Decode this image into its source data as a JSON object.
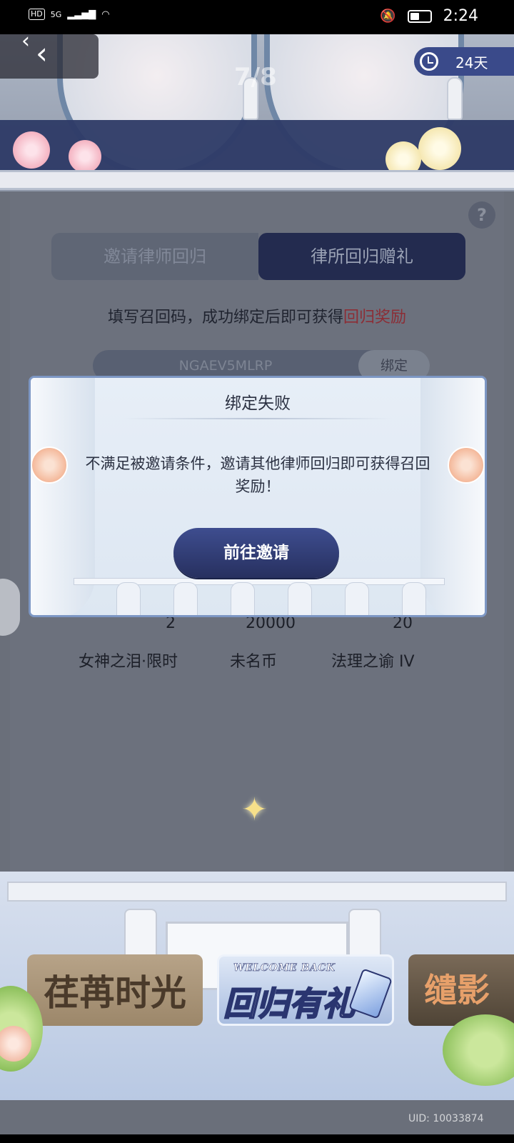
{
  "status_bar": {
    "hd": "HD",
    "network": "5G",
    "time": "2:24"
  },
  "header": {
    "page_indicator": "7/8",
    "timer": "24天"
  },
  "tabs": [
    {
      "label": "邀请律师回归",
      "active": false
    },
    {
      "label": "律所回归赠礼",
      "active": true
    }
  ],
  "instruction": {
    "text": "填写召回码，成功绑定后即可获得",
    "highlight": "回归奖励"
  },
  "code_input": {
    "value": "NGAEV5MLRP",
    "bind_label": "绑定"
  },
  "rewards": [
    {
      "count": "2",
      "label": "女神之泪·限时"
    },
    {
      "count": "20000",
      "label": "未名币"
    },
    {
      "count": "20",
      "label": "法理之谕 IV"
    }
  ],
  "modal": {
    "title": "绑定失败",
    "message": "不满足被邀请条件，邀请其他律师回归即可获得召回奖励！",
    "button": "前往邀请"
  },
  "banners": [
    {
      "title": "荏苒时光"
    },
    {
      "subtitle": "WELCOME BACK",
      "title": "回归有礼"
    },
    {
      "title": "缱影"
    }
  ],
  "uid": "UID: 10033874",
  "colors": {
    "accent_navy": "#27305f",
    "highlight_red": "#8c2d35",
    "modal_bg": "#e7eef7"
  }
}
